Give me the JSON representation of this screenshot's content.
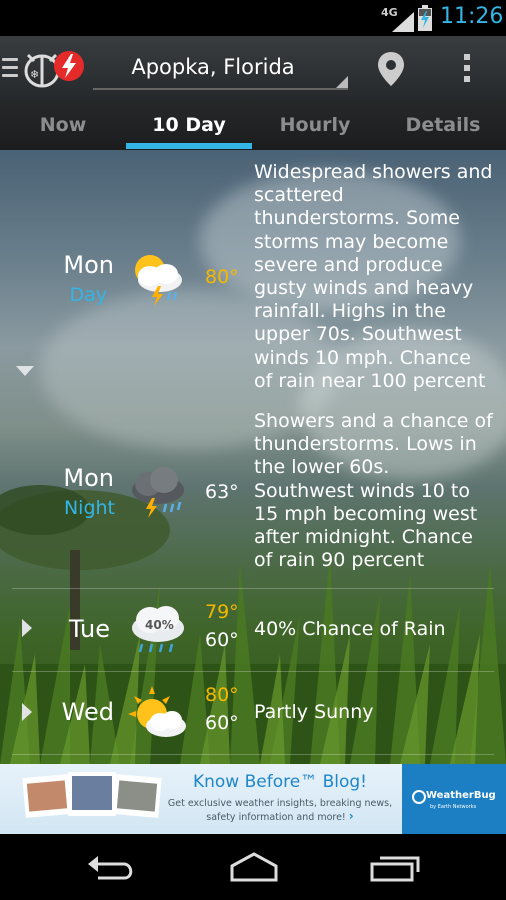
{
  "status_bar": {
    "network": "4G",
    "time": "11:26"
  },
  "app_bar": {
    "location": "Apopka, Florida"
  },
  "tabs": [
    {
      "label": "Now",
      "active": false
    },
    {
      "label": "10 Day",
      "active": true
    },
    {
      "label": "Hourly",
      "active": false
    },
    {
      "label": "Details",
      "active": false
    }
  ],
  "forecast": [
    {
      "day": "Mon",
      "period": "Day",
      "icon": "thunderstorm-day-icon",
      "high": "80°",
      "low": "",
      "description": "Widespread showers and scattered thunderstorms. Some storms may become severe and produce gusty winds and heavy rainfall. Highs in the upper 70s. Southwest winds 10 mph. Chance of rain near 100 percent"
    },
    {
      "day": "Mon",
      "period": "Night",
      "icon": "thunderstorm-night-icon",
      "high": "",
      "low": "63°",
      "description": "Showers and a chance of thunderstorms. Lows in the lower 60s. Southwest winds 10 to 15 mph becoming west after midnight. Chance of rain 90 percent"
    },
    {
      "day": "Tue",
      "period": "",
      "icon": "rain-cloud-icon",
      "icon_label": "40%",
      "high": "79°",
      "low": "60°",
      "description": "40% Chance of Rain"
    },
    {
      "day": "Wed",
      "period": "",
      "icon": "partly-sunny-icon",
      "high": "80°",
      "low": "60°",
      "description": "Partly Sunny"
    }
  ],
  "ad": {
    "title": "Know Before™ Blog!",
    "subtitle": "Get exclusive weather insights, breaking news, safety information and more!",
    "link_arrow": "›",
    "brand": "WeatherBug",
    "brand_sub": "by Earth Networks"
  },
  "colors": {
    "accent": "#33b5e5",
    "high_temp": "#f5b800"
  }
}
